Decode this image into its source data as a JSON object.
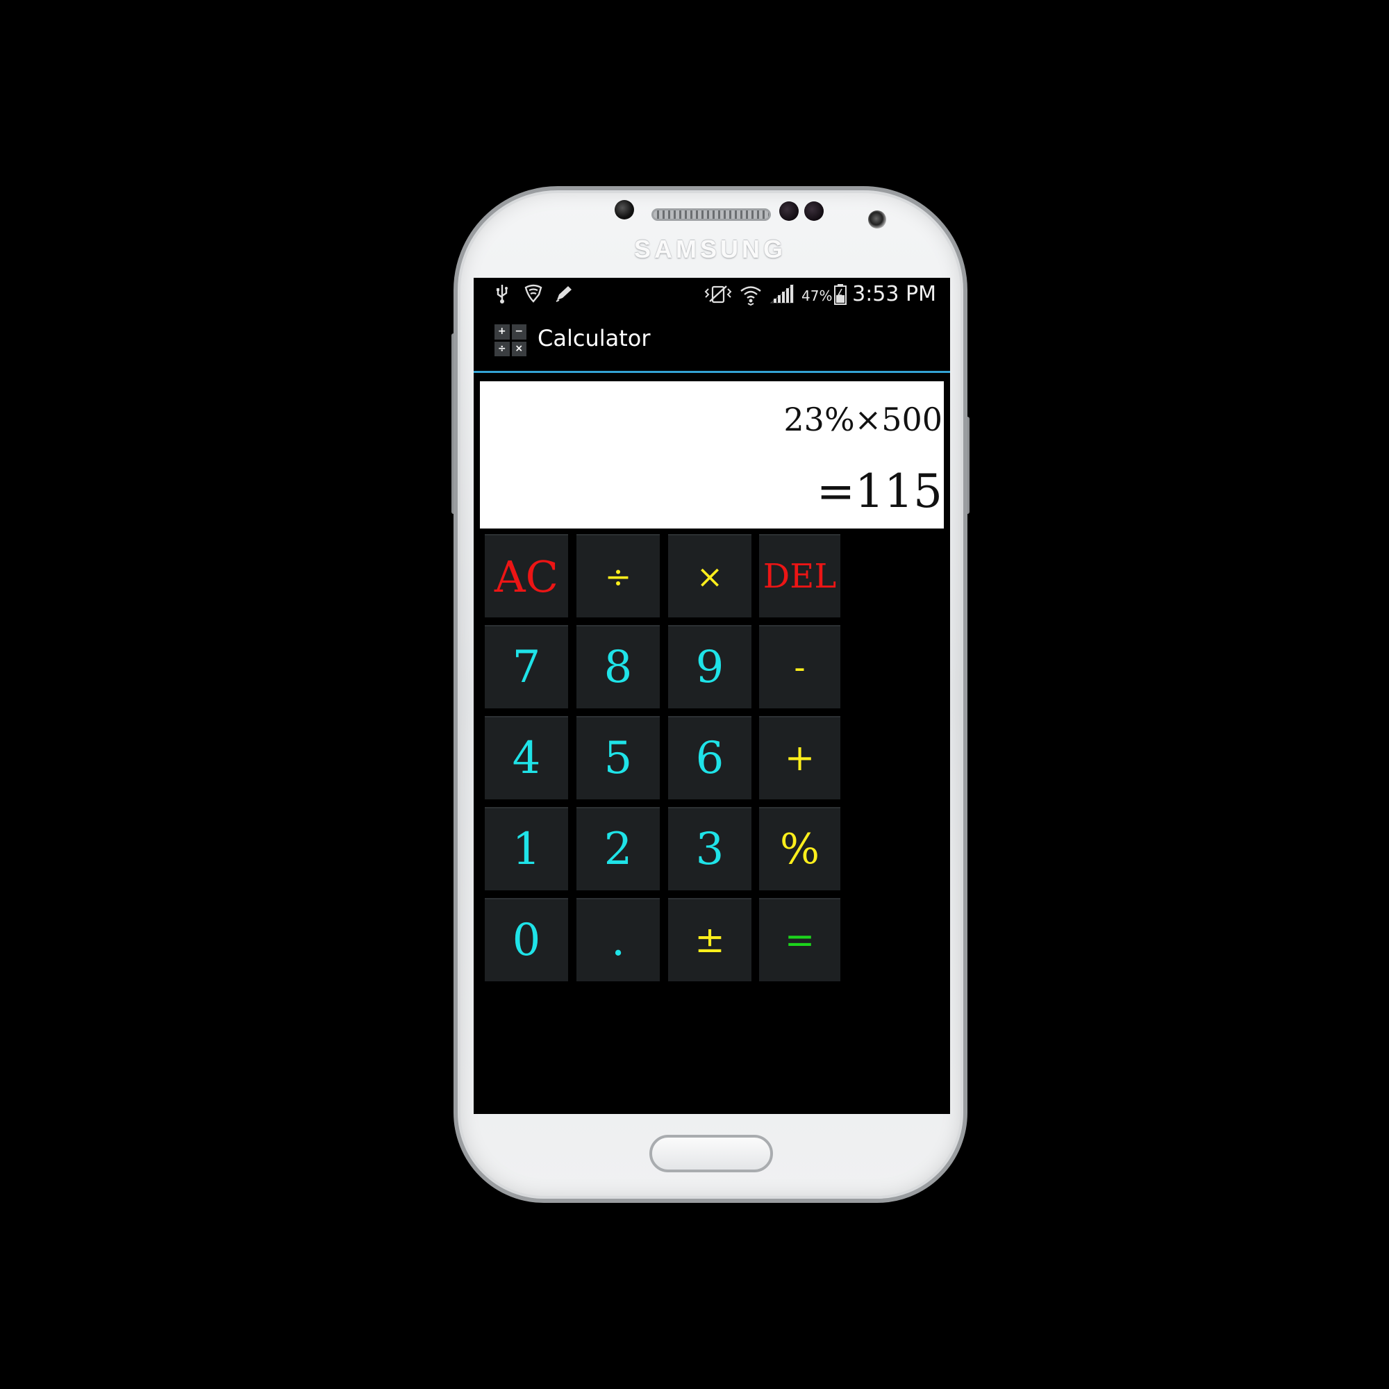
{
  "device": {
    "brand": "SAMSUNG"
  },
  "status_bar": {
    "left_icons": [
      "usb-icon",
      "shield-icon",
      "pencil-icon"
    ],
    "right_icons": [
      "vibrate-icon",
      "wifi-icon",
      "signal-icon",
      "battery-icon"
    ],
    "battery": "47%",
    "time": "3:53 PM"
  },
  "app": {
    "title": "Calculator",
    "icon_symbols": [
      "+",
      "−",
      "÷",
      "×"
    ]
  },
  "display": {
    "expression": "23%×500",
    "result": "=115"
  },
  "keypad": {
    "keys": [
      {
        "label": "AC",
        "name": "key-ac",
        "color": "#ec1515"
      },
      {
        "label": "÷",
        "name": "key-divide",
        "color": "#ffef1c"
      },
      {
        "label": "×",
        "name": "key-multiply",
        "color": "#ffef1c"
      },
      {
        "label": "DEL",
        "name": "key-del",
        "color": "#ec1515"
      },
      {
        "label": "7",
        "name": "key-7",
        "color": "#1fe3e8"
      },
      {
        "label": "8",
        "name": "key-8",
        "color": "#1fe3e8"
      },
      {
        "label": "9",
        "name": "key-9",
        "color": "#1fe3e8"
      },
      {
        "label": "-",
        "name": "key-minus",
        "color": "#ffef1c"
      },
      {
        "label": "4",
        "name": "key-4",
        "color": "#1fe3e8"
      },
      {
        "label": "5",
        "name": "key-5",
        "color": "#1fe3e8"
      },
      {
        "label": "6",
        "name": "key-6",
        "color": "#1fe3e8"
      },
      {
        "label": "+",
        "name": "key-plus",
        "color": "#ffef1c"
      },
      {
        "label": "1",
        "name": "key-1",
        "color": "#1fe3e8"
      },
      {
        "label": "2",
        "name": "key-2",
        "color": "#1fe3e8"
      },
      {
        "label": "3",
        "name": "key-3",
        "color": "#1fe3e8"
      },
      {
        "label": "%",
        "name": "key-percent",
        "color": "#ffef1c"
      },
      {
        "label": "0",
        "name": "key-0",
        "color": "#1fe3e8"
      },
      {
        "label": ".",
        "name": "key-decimal",
        "color": "#1fe3e8"
      },
      {
        "label": "±",
        "name": "key-plus-minus",
        "color": "#ffef1c"
      },
      {
        "label": "=",
        "name": "key-equals",
        "color": "#1cd41c"
      }
    ]
  },
  "colors": {
    "accent_line": "#33a3d4",
    "key_background": "#1d2022"
  }
}
